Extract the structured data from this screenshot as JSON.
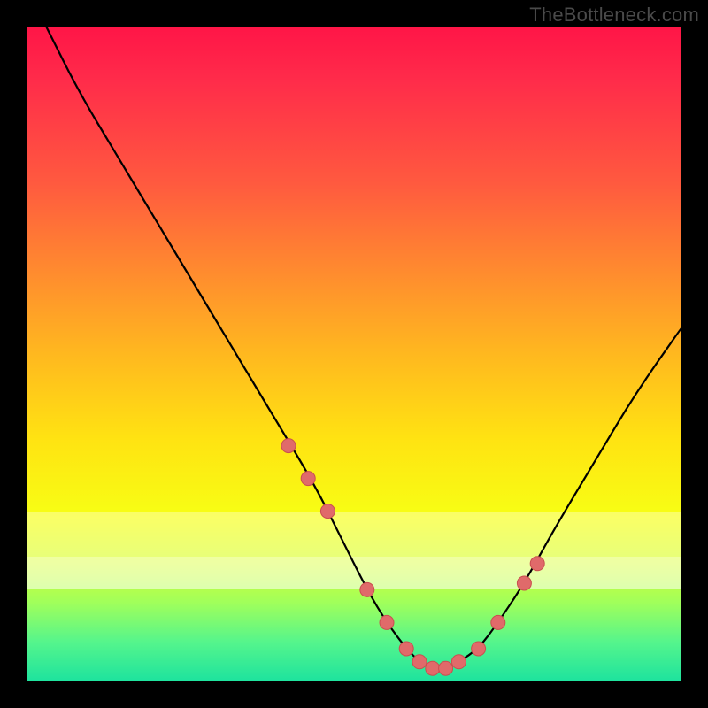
{
  "watermark": "TheBottleneck.com",
  "colors": {
    "background": "#000000",
    "curve_stroke": "#000000",
    "dot_fill": "#e06a6a",
    "dot_stroke": "#c94f4f"
  },
  "chart_data": {
    "type": "line",
    "title": "",
    "xlabel": "",
    "ylabel": "",
    "xlim": [
      0,
      100
    ],
    "ylim": [
      0,
      100
    ],
    "grid": false,
    "legend": false,
    "series": [
      {
        "name": "bottleneck-curve",
        "x": [
          3,
          8,
          14,
          20,
          26,
          32,
          38,
          44,
          48,
          52,
          55,
          58,
          60,
          62,
          64,
          66,
          69,
          72,
          76,
          81,
          87,
          93,
          100
        ],
        "y": [
          100,
          90,
          80,
          70,
          60,
          50,
          40,
          30,
          22,
          14,
          9,
          5,
          3,
          2,
          2,
          3,
          5,
          9,
          15,
          24,
          34,
          44,
          54
        ]
      }
    ],
    "dots": {
      "name": "highlight-points",
      "x": [
        40,
        43,
        46,
        52,
        55,
        58,
        60,
        62,
        64,
        66,
        69,
        72,
        76,
        78
      ],
      "y": [
        36,
        31,
        26,
        14,
        9,
        5,
        3,
        2,
        2,
        3,
        5,
        9,
        15,
        18
      ]
    },
    "bands": [
      {
        "y_from": 26,
        "y_to": 19,
        "style": "pale"
      },
      {
        "y_from": 19,
        "y_to": 14,
        "style": "bright"
      }
    ]
  }
}
